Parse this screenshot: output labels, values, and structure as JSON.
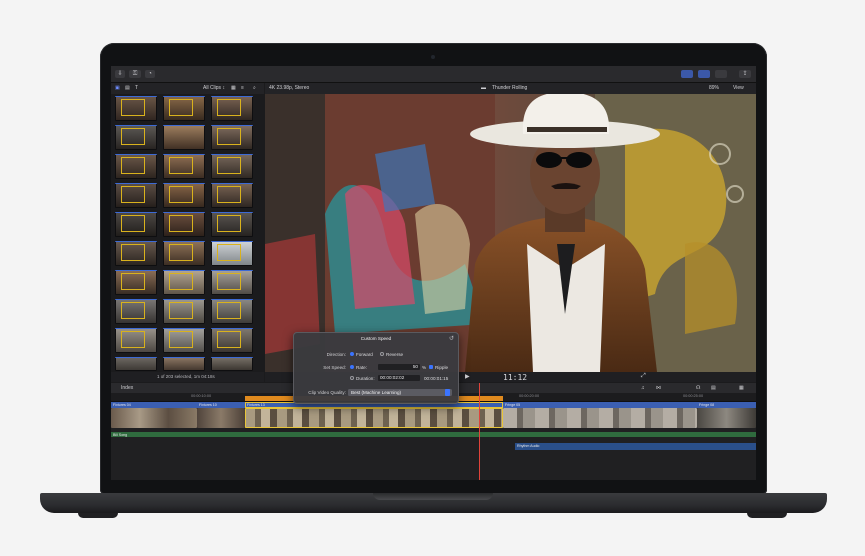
{
  "browser": {
    "filter_label": "All Clips ↕",
    "selection_status": "1 of 203 selected, 1m 04:18s"
  },
  "viewer": {
    "format_label": "4K 23.98p, Stereo",
    "project_title": "Thunder Rolling",
    "zoom_label": "89%",
    "view_label": "View",
    "timecode": "11:12"
  },
  "custom_speed": {
    "title": "Custom Speed",
    "direction_label": "Direction:",
    "forward_label": "Forward",
    "reverse_label": "Reverse",
    "set_speed_label": "Set Speed:",
    "rate_label": "Rate:",
    "rate_value": "50",
    "rate_unit": "%",
    "ripple_label": "Ripple",
    "duration_label": "Duration:",
    "duration_value": "00:00:02:02",
    "duration_total": "00:00:01:15",
    "quality_label": "Clip Video Quality:",
    "quality_value": "Best (Machine Learning)"
  },
  "timeline": {
    "index_label": "Index",
    "ruler": [
      "00:00:10:00",
      "00:00:15:00",
      "00:00:20:00",
      "00:00:25:00"
    ],
    "clip_titles": [
      "Fixtures 04",
      "Fixtures 10",
      "Fixtures 13",
      "Fringe 05",
      "Fringe 08",
      "Slow 50% →"
    ],
    "audio_title": "Rhythm Audio",
    "music_title": "Bill Song"
  },
  "colors": {
    "accent_blue": "#3b74ff",
    "retime_orange": "#e08a1e",
    "selection_yellow": "#d9b21d",
    "playhead_red": "#e0433a"
  }
}
